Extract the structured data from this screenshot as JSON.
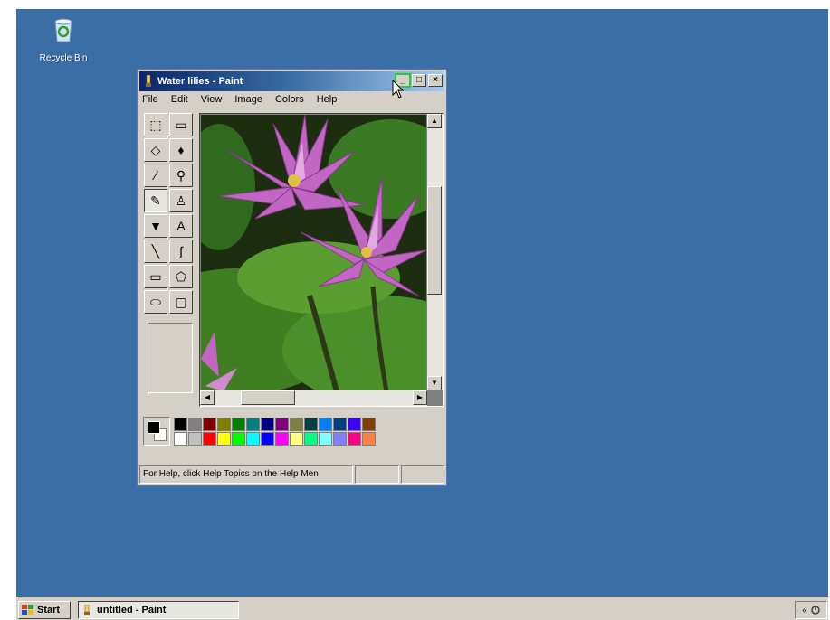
{
  "desktop": {
    "background_color": "#3a6ea5",
    "icons": [
      {
        "label": "Recycle Bin",
        "icon": "recycle-bin-icon"
      }
    ]
  },
  "window": {
    "title": "Water lilies - Paint",
    "buttons": {
      "minimize": "_",
      "maximize": "□",
      "close": "×"
    },
    "menu": [
      "File",
      "Edit",
      "View",
      "Image",
      "Colors",
      "Help"
    ],
    "tools": [
      {
        "name": "free-form-select",
        "glyph": "⬚"
      },
      {
        "name": "select",
        "glyph": "▭"
      },
      {
        "name": "eraser",
        "glyph": "◇"
      },
      {
        "name": "fill",
        "glyph": "♦"
      },
      {
        "name": "pick-color",
        "glyph": "⁄"
      },
      {
        "name": "magnifier",
        "glyph": "⚲"
      },
      {
        "name": "pencil",
        "glyph": "✎"
      },
      {
        "name": "brush",
        "glyph": "♙"
      },
      {
        "name": "airbrush",
        "glyph": "▼"
      },
      {
        "name": "text",
        "glyph": "A"
      },
      {
        "name": "line",
        "glyph": "╲"
      },
      {
        "name": "curve",
        "glyph": "∫"
      },
      {
        "name": "rectangle",
        "glyph": "▭"
      },
      {
        "name": "polygon",
        "glyph": "⬠"
      },
      {
        "name": "ellipse",
        "glyph": "⬭"
      },
      {
        "name": "rounded-rectangle",
        "glyph": "▢"
      }
    ],
    "selected_tool": "pencil",
    "palette": {
      "foreground": "#000000",
      "background": "#ffffff",
      "colors": [
        "#000000",
        "#808080",
        "#800000",
        "#808000",
        "#008000",
        "#008080",
        "#000080",
        "#800080",
        "#808040",
        "#004040",
        "#0080ff",
        "#004080",
        "#4000ff",
        "#804000",
        "#ffffff",
        "#c0c0c0",
        "#ff0000",
        "#ffff00",
        "#00ff00",
        "#00ffff",
        "#0000ff",
        "#ff00ff",
        "#ffff80",
        "#00ff80",
        "#80ffff",
        "#8080ff",
        "#ff0080",
        "#ff8040"
      ]
    },
    "status": "For Help, click Help Topics on the Help Men"
  },
  "taskbar": {
    "start_label": "Start",
    "tasks": [
      {
        "label": "untitled - Paint"
      }
    ],
    "tray_text": "«"
  }
}
